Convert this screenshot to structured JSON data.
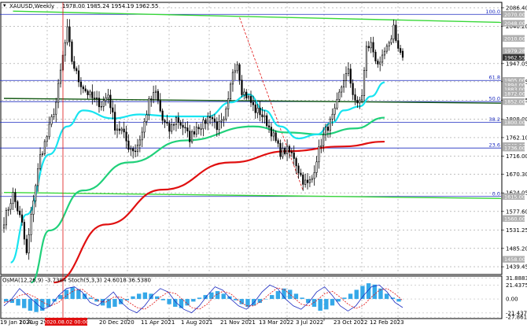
{
  "header": {
    "symbol_label": "XAUUSD,Weekly",
    "ohlc": "1978.00 1985.24 1954.19 1962.55"
  },
  "osc_header": "OsMA(12,26,9) -3.7384  Stoch(5,3,3) 24.6018 36.5380",
  "colors": {
    "ma_red": "#e01010",
    "ma_green": "#20d07a",
    "ma_cyan": "#18e4f0",
    "fib_blue": "#1d2cc0",
    "trend_green": "#38d838",
    "candle": "#000000",
    "osma_bar": "#35a8e8",
    "stoch_main": "#1d2cc0",
    "stoch_signal": "#e01010",
    "marker": "#e01010",
    "price_box": "#8a8a8a",
    "level_box": "#b0b0b0",
    "dark_box": "#333333"
  },
  "chart_data": {
    "type": "candlestick",
    "symbol": "XAUUSD",
    "timeframe": "Weekly",
    "last_bar": {
      "open": 1978.0,
      "high": 1985.24,
      "low": 1954.19,
      "close": 1962.55
    },
    "ylim": [
      1420,
      2100
    ],
    "y_ticks": [
      2086.4,
      2040.2,
      1947.05,
      1901.85,
      1855.35,
      1808.0,
      1762.1,
      1716.0,
      1670.3,
      1624.05,
      1577.6,
      1531.25,
      1485.2,
      1439.45
    ],
    "x_labels": [
      "19 Jan 2020",
      "10 Aug 2020",
      "2020.08.02 00:00",
      "20 Dec 2020",
      "11 Apr 2021",
      "1 Aug 2021",
      "21 Nov 2021",
      "13 Mar 2022",
      "3 Jul 2022",
      "23 Oct 2022",
      "12 Feb 2023"
    ],
    "x_index_span": [
      0,
      176
    ],
    "weekly_close_anchors": [
      [
        0,
        1555
      ],
      [
        4,
        1620
      ],
      [
        8,
        1545
      ],
      [
        10,
        1470
      ],
      [
        13,
        1610
      ],
      [
        16,
        1715
      ],
      [
        19,
        1765
      ],
      [
        23,
        1850
      ],
      [
        26,
        1965
      ],
      [
        28,
        2030
      ],
      [
        30,
        1955
      ],
      [
        33,
        1905
      ],
      [
        36,
        1880
      ],
      [
        39,
        1860
      ],
      [
        43,
        1845
      ],
      [
        46,
        1870
      ],
      [
        49,
        1790
      ],
      [
        52,
        1780
      ],
      [
        55,
        1740
      ],
      [
        58,
        1730
      ],
      [
        61,
        1775
      ],
      [
        64,
        1850
      ],
      [
        67,
        1875
      ],
      [
        70,
        1805
      ],
      [
        73,
        1780
      ],
      [
        76,
        1810
      ],
      [
        79,
        1790
      ],
      [
        82,
        1760
      ],
      [
        85,
        1790
      ],
      [
        88,
        1795
      ],
      [
        91,
        1820
      ],
      [
        94,
        1790
      ],
      [
        97,
        1800
      ],
      [
        99,
        1850
      ],
      [
        101,
        1930
      ],
      [
        103,
        1950
      ],
      [
        105,
        1880
      ],
      [
        108,
        1860
      ],
      [
        111,
        1830
      ],
      [
        113,
        1825
      ],
      [
        116,
        1800
      ],
      [
        119,
        1765
      ],
      [
        122,
        1725
      ],
      [
        125,
        1730
      ],
      [
        128,
        1715
      ],
      [
        130,
        1680
      ],
      [
        132,
        1655
      ],
      [
        134,
        1645
      ],
      [
        136,
        1660
      ],
      [
        138,
        1710
      ],
      [
        140,
        1750
      ],
      [
        142,
        1780
      ],
      [
        144,
        1800
      ],
      [
        146,
        1825
      ],
      [
        148,
        1870
      ],
      [
        150,
        1910
      ],
      [
        152,
        1925
      ],
      [
        154,
        1875
      ],
      [
        156,
        1840
      ],
      [
        158,
        1870
      ],
      [
        160,
        1985
      ],
      [
        162,
        1995
      ],
      [
        164,
        1960
      ],
      [
        166,
        1940
      ],
      [
        168,
        1975
      ],
      [
        170,
        1990
      ],
      [
        172,
        2040
      ],
      [
        174,
        1985
      ],
      [
        176,
        1962
      ]
    ],
    "moving_averages": [
      {
        "name": "MA red",
        "color": "#e01010",
        "points": [
          [
            22,
            1400
          ],
          [
            45,
            1545
          ],
          [
            70,
            1632
          ],
          [
            100,
            1700
          ],
          [
            125,
            1728
          ],
          [
            150,
            1740
          ],
          [
            168,
            1752
          ]
        ]
      },
      {
        "name": "MA green",
        "color": "#20d07a",
        "points": [
          [
            12,
            1400
          ],
          [
            20,
            1530
          ],
          [
            35,
            1630
          ],
          [
            55,
            1700
          ],
          [
            80,
            1755
          ],
          [
            110,
            1790
          ],
          [
            125,
            1775
          ],
          [
            140,
            1770
          ],
          [
            155,
            1785
          ],
          [
            168,
            1812
          ]
        ]
      },
      {
        "name": "MA cyan",
        "color": "#18e4f0",
        "points": [
          [
            3,
            1450
          ],
          [
            10,
            1570
          ],
          [
            20,
            1720
          ],
          [
            28,
            1790
          ],
          [
            35,
            1830
          ],
          [
            48,
            1810
          ],
          [
            60,
            1820
          ],
          [
            75,
            1815
          ],
          [
            90,
            1815
          ],
          [
            100,
            1850
          ],
          [
            108,
            1870
          ],
          [
            115,
            1830
          ],
          [
            122,
            1790
          ],
          [
            130,
            1760
          ],
          [
            138,
            1770
          ],
          [
            145,
            1800
          ],
          [
            150,
            1830
          ],
          [
            157,
            1840
          ],
          [
            162,
            1865
          ],
          [
            168,
            1900
          ]
        ]
      }
    ],
    "fib_levels": [
      {
        "pct": "100.0",
        "price": 2070.0
      },
      {
        "pct": "61.8",
        "price": 1905.0
      },
      {
        "pct": "50.0",
        "price": 1852.0
      },
      {
        "pct": "38.2",
        "price": 1800.0
      },
      {
        "pct": "23.6",
        "price": 1736.0
      },
      {
        "pct": "0.0",
        "price": 1615.0
      }
    ],
    "level_labels": [
      "2070.00",
      "2048.00",
      "2010.00",
      "1979.28",
      "1962.55",
      "1905.00",
      "1894.00",
      "1883.00",
      "1872.00",
      "1852.00",
      "1800.00",
      "1742.00",
      "1736.00",
      "1615.00",
      "1560.00",
      "1458.00"
    ],
    "price_label_highlight": "1962.55",
    "marker_label": "2020.08.02 00:00",
    "trendlines": [
      {
        "name": "upper green",
        "color": "#38d838",
        "from": [
          4,
          2078
        ],
        "to": [
          176,
          2050
        ]
      },
      {
        "name": "lower green",
        "color": "#38d838",
        "from": [
          0,
          1625
        ],
        "to": [
          176,
          1610
        ]
      },
      {
        "name": "dark green",
        "color": "#1a5e1a",
        "from": [
          0,
          1860
        ],
        "to": [
          176,
          1848
        ]
      },
      {
        "name": "dashed red",
        "color": "#e01010",
        "from": [
          104,
          2062
        ],
        "to": [
          132,
          1630
        ]
      }
    ],
    "oscillator": {
      "ylim": [
        -30,
        35
      ],
      "y_ticks": [
        31.8883,
        21.4375,
        0.0,
        -21.4375,
        -27.8615
      ],
      "osma": [
        -4,
        -6,
        -10,
        -14,
        -18,
        -20,
        -18,
        -12,
        -4,
        6,
        14,
        18,
        14,
        8,
        2,
        -4,
        -10,
        -14,
        -12,
        -8,
        -2,
        4,
        8,
        10,
        8,
        4,
        -2,
        -8,
        -12,
        -14,
        -10,
        -4,
        2,
        6,
        10,
        12,
        8,
        4,
        -2,
        -8,
        -12,
        -10,
        -6,
        0,
        6,
        12,
        16,
        14,
        8,
        2,
        -6,
        -12,
        -18,
        -16,
        -10,
        -4,
        2,
        8,
        14,
        20,
        24,
        22,
        16,
        8,
        2,
        -4
      ],
      "stoch_main": [
        30,
        50,
        80,
        60,
        40,
        20,
        30,
        60,
        80,
        85,
        70,
        40,
        30,
        50,
        70,
        40,
        20,
        10,
        30,
        60,
        80,
        70,
        40,
        20,
        10,
        30,
        60,
        85,
        75,
        50,
        30,
        20,
        40,
        70,
        90,
        80,
        50,
        30,
        20,
        40,
        70,
        85,
        60,
        30,
        15,
        30,
        60,
        85,
        90,
        70,
        40,
        25
      ],
      "stoch_signal": [
        40,
        45,
        60,
        65,
        55,
        40,
        30,
        40,
        60,
        75,
        78,
        60,
        45,
        40,
        55,
        55,
        40,
        25,
        20,
        35,
        55,
        70,
        65,
        45,
        25,
        20,
        35,
        60,
        72,
        65,
        45,
        30,
        30,
        45,
        65,
        82,
        75,
        55,
        35,
        30,
        45,
        65,
        72,
        55,
        35,
        22,
        32,
        55,
        75,
        80,
        65,
        45
      ]
    }
  }
}
